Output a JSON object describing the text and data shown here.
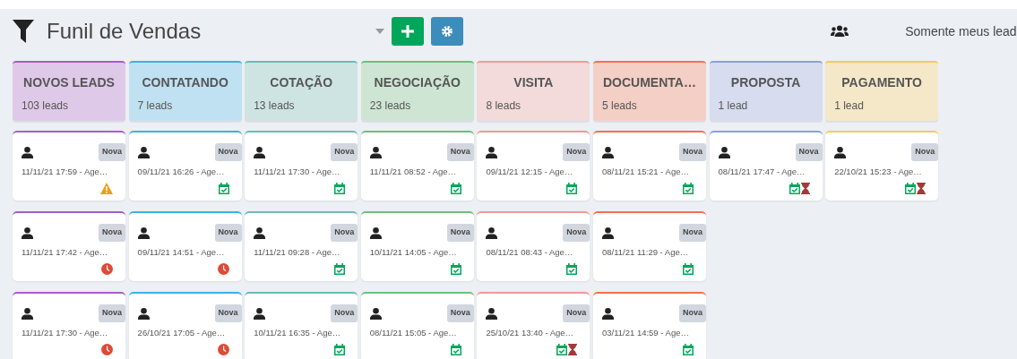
{
  "header": {
    "title": "Funil de Vendas",
    "filter_label": "Somente meus lead"
  },
  "stages": [
    {
      "name": "NOVOS LEADS",
      "count": "103 leads",
      "color": "#a95cc9",
      "cards": [
        {
          "badge": "Nova",
          "text": "11/11/21 17:59 - Age…",
          "icons": [
            {
              "kind": "warning"
            }
          ]
        },
        {
          "badge": "Nova",
          "text": "11/11/21 17:42 - Age…",
          "icons": [
            {
              "kind": "late"
            }
          ]
        },
        {
          "badge": "Nova",
          "text": "11/11/21 17:30 - Age…",
          "icons": [
            {
              "kind": "late"
            }
          ]
        }
      ]
    },
    {
      "name": "CONTATANDO",
      "count": "7 leads",
      "color": "#3bb1e8",
      "cards": [
        {
          "badge": "Nova",
          "text": "09/11/21 16:26 - Age…",
          "icons": [
            {
              "kind": "scheduled"
            }
          ]
        },
        {
          "badge": "Nova",
          "text": "09/11/21 14:51 - Age…",
          "icons": [
            {
              "kind": "late"
            }
          ]
        },
        {
          "badge": "Nova",
          "text": "26/10/21 17:05 - Age…",
          "icons": [
            {
              "kind": "late"
            }
          ]
        }
      ]
    },
    {
      "name": "COTAÇÃO",
      "count": "13 leads",
      "color": "#6bbcb4",
      "cards": [
        {
          "badge": "Nova",
          "text": "11/11/21 17:30 - Age…",
          "icons": [
            {
              "kind": "scheduled"
            }
          ]
        },
        {
          "badge": "Nova",
          "text": "11/11/21 09:28 - Age…",
          "icons": [
            {
              "kind": "scheduled"
            }
          ]
        },
        {
          "badge": "Nova",
          "text": "10/11/21 16:35 - Age…",
          "icons": [
            {
              "kind": "scheduled"
            }
          ]
        }
      ]
    },
    {
      "name": "NEGOCIAÇÃO",
      "count": "23 leads",
      "color": "#6cc07e",
      "cards": [
        {
          "badge": "Nova",
          "text": "11/11/21 08:52 - Age…",
          "icons": [
            {
              "kind": "scheduled"
            }
          ]
        },
        {
          "badge": "Nova",
          "text": "10/11/21 14:05 - Age…",
          "icons": [
            {
              "kind": "scheduled"
            }
          ]
        },
        {
          "badge": "Nova",
          "text": "08/11/21 15:05 - Age…",
          "icons": [
            {
              "kind": "scheduled"
            }
          ]
        }
      ]
    },
    {
      "name": "VISITA",
      "count": "8 leads",
      "color": "#ef9a9a",
      "cards": [
        {
          "badge": "Nova",
          "text": "09/11/21 12:15 - Age…",
          "icons": [
            {
              "kind": "scheduled"
            }
          ]
        },
        {
          "badge": "Nova",
          "text": "08/11/21 08:43 - Age…",
          "icons": [
            {
              "kind": "scheduled"
            }
          ]
        },
        {
          "badge": "Nova",
          "text": "25/10/21 13:40 - Age…",
          "icons": [
            {
              "kind": "scheduled"
            },
            {
              "kind": "waiting"
            }
          ]
        }
      ]
    },
    {
      "name": "DOCUMENTA…",
      "count": "5 leads",
      "color": "#f5704d",
      "cards": [
        {
          "badge": "Nova",
          "text": "08/11/21 15:21 - Age…",
          "icons": [
            {
              "kind": "scheduled"
            }
          ]
        },
        {
          "badge": "Nova",
          "text": "08/11/21 11:29 - Age…",
          "icons": [
            {
              "kind": "scheduled"
            }
          ]
        },
        {
          "badge": "Nova",
          "text": "03/11/21 14:59 - Age…",
          "icons": [
            {
              "kind": "scheduled"
            }
          ]
        }
      ]
    },
    {
      "name": "PROPOSTA",
      "count": "1 lead",
      "color": "#8c9ee0",
      "cards": [
        {
          "badge": "Nova",
          "text": "08/11/21 17:47 - Age…",
          "icons": [
            {
              "kind": "scheduled"
            },
            {
              "kind": "waiting"
            }
          ]
        }
      ]
    },
    {
      "name": "PAGAMENTO",
      "count": "1 lead",
      "color": "#f7c95c",
      "cards": [
        {
          "badge": "Nova",
          "text": "22/10/21 15:23 - Age…",
          "icons": [
            {
              "kind": "scheduled"
            },
            {
              "kind": "waiting"
            }
          ]
        }
      ]
    }
  ]
}
